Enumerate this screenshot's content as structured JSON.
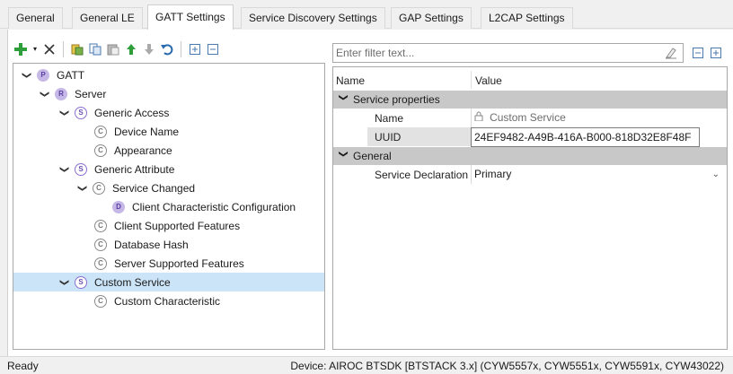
{
  "tabs": [
    {
      "label": "General",
      "active": false
    },
    {
      "label": "General LE",
      "active": false
    },
    {
      "label": "GATT Settings",
      "active": true
    },
    {
      "label": "Service Discovery Settings",
      "active": false
    },
    {
      "label": "GAP Settings",
      "active": false
    },
    {
      "label": "L2CAP Settings",
      "active": false
    }
  ],
  "toolbar": {
    "add_icon": "plus-icon",
    "remove_icon": "x-icon",
    "colors": {
      "add": "#2e9e3a",
      "remove": "#333333",
      "up": "#2e9e3a"
    }
  },
  "tree": {
    "nodes": [
      {
        "label": "GATT",
        "icon": "P",
        "expanded": true
      },
      {
        "label": "Server",
        "icon": "R",
        "expanded": true
      },
      {
        "label": "Generic Access",
        "icon": "S",
        "expanded": true
      },
      {
        "label": "Device Name",
        "icon": "C"
      },
      {
        "label": "Appearance",
        "icon": "C"
      },
      {
        "label": "Generic Attribute",
        "icon": "S",
        "expanded": true
      },
      {
        "label": "Service Changed",
        "icon": "C",
        "expanded": true
      },
      {
        "label": "Client Characteristic Configuration",
        "icon": "D"
      },
      {
        "label": "Client Supported Features",
        "icon": "C"
      },
      {
        "label": "Database Hash",
        "icon": "C"
      },
      {
        "label": "Server Supported Features",
        "icon": "C"
      },
      {
        "label": "Custom Service",
        "icon": "S",
        "expanded": true,
        "selected": true
      },
      {
        "label": "Custom Characteristic",
        "icon": "C"
      }
    ]
  },
  "filter": {
    "placeholder": "Enter filter text..."
  },
  "properties": {
    "col_name": "Name",
    "col_value": "Value",
    "sections": [
      {
        "title": "Service properties",
        "rows": [
          {
            "name": "Name",
            "value": "Custom Service",
            "readonly": true
          },
          {
            "name": "UUID",
            "value": "24EF9482-A49B-416A-B000-818D32E8F48F",
            "editing": true
          }
        ]
      },
      {
        "title": "General",
        "rows": [
          {
            "name": "Service Declaration",
            "value": "Primary",
            "dropdown": true
          }
        ]
      }
    ]
  },
  "status": {
    "left": "Ready",
    "right": "Device: AIROC BTSDK [BTSTACK 3.x] (CYW5557x, CYW5551x, CYW5591x, CYW43022)"
  }
}
